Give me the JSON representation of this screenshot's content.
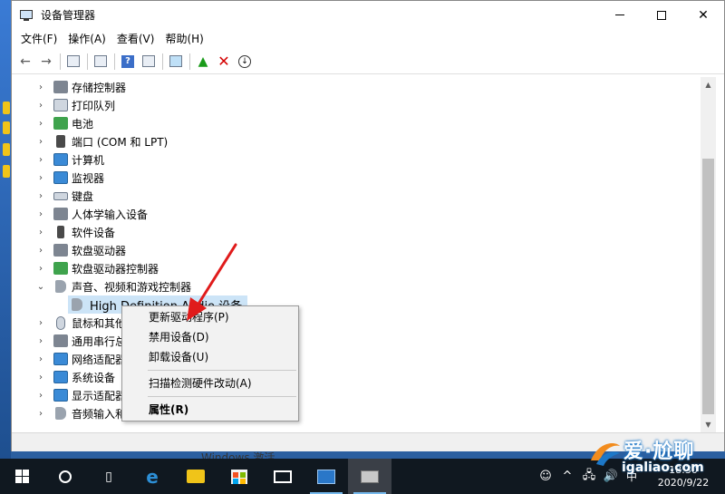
{
  "window": {
    "title": "设备管理器",
    "controls": {
      "minimize": "—",
      "maximize": "□",
      "close": "✕"
    }
  },
  "menu": [
    "文件(F)",
    "操作(A)",
    "查看(V)",
    "帮助(H)"
  ],
  "toolbar": {
    "back_icon": "←",
    "forward_icon": "→",
    "help_icon": "?",
    "uninstall_icon": "✕",
    "update_icon": "↓",
    "add_icon": "▲"
  },
  "tree": {
    "items": [
      {
        "label": "存储控制器",
        "expander": "›"
      },
      {
        "label": "打印队列",
        "expander": "›"
      },
      {
        "label": "电池",
        "expander": "›"
      },
      {
        "label": "端口 (COM 和 LPT)",
        "expander": "›"
      },
      {
        "label": "计算机",
        "expander": "›"
      },
      {
        "label": "监视器",
        "expander": "›"
      },
      {
        "label": "键盘",
        "expander": "›"
      },
      {
        "label": "人体学输入设备",
        "expander": "›"
      },
      {
        "label": "软件设备",
        "expander": "›"
      },
      {
        "label": "软盘驱动器",
        "expander": "›"
      },
      {
        "label": "软盘驱动器控制器",
        "expander": "›"
      },
      {
        "label": "声音、视频和游戏控制器",
        "expander": "⌄"
      },
      {
        "label": "鼠标和其他",
        "expander": "›"
      },
      {
        "label": "通用串行总",
        "expander": "›"
      },
      {
        "label": "网络适配器",
        "expander": "›"
      },
      {
        "label": "系统设备",
        "expander": "›"
      },
      {
        "label": "显示适配器",
        "expander": "›"
      },
      {
        "label": "音频输入和",
        "expander": "›"
      }
    ],
    "child_selected": "High Definition Audio 设备"
  },
  "context_menu": {
    "update_driver": "更新驱动程序(P)",
    "disable_device": "禁用设备(D)",
    "uninstall_device": "卸载设备(U)",
    "scan_hardware": "扫描检测硬件改动(A)",
    "properties": "属性(R)"
  },
  "activate_windows_text": "Windows 激活",
  "taskbar": {
    "tray": {
      "network_icon": "🖧",
      "volume_icon": "🔊",
      "ime": "中",
      "people_icon": "☺",
      "arrow_icon": "^"
    },
    "clock": {
      "time": "18:30",
      "date": "2020/9/22"
    }
  },
  "watermark": {
    "name": "爱·尬聊",
    "site": "igaliao.com"
  },
  "colors": {
    "selection": "#cce4f7",
    "accent": "#0078d7",
    "arrow": "#e01b1b",
    "taskbar": "#101820"
  }
}
